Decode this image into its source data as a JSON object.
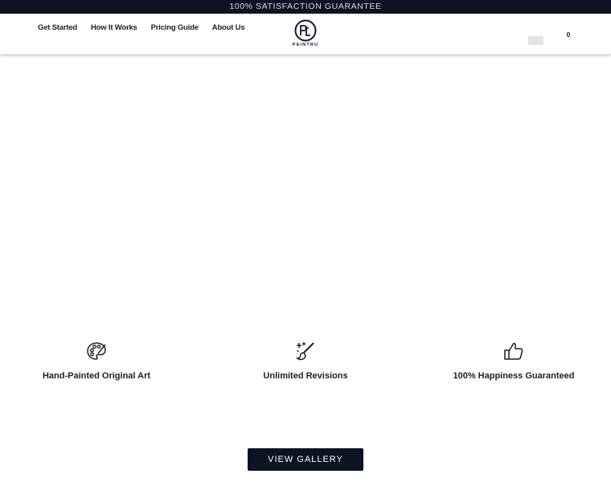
{
  "announcement": "100% SATISFACTION GUARANTEE",
  "nav": {
    "items": [
      {
        "label": "Get Started"
      },
      {
        "label": "How It Works"
      },
      {
        "label": "Pricing Guide"
      },
      {
        "label": "About Us"
      }
    ]
  },
  "logo": {
    "monogram": "PtL",
    "wordmark": "PAINTRU"
  },
  "cart": {
    "count": "0",
    "icon": "cart-icon"
  },
  "features": [
    {
      "icon": "palette-icon",
      "label": "Hand-Painted Original Art"
    },
    {
      "icon": "brush-sparkle-icon",
      "label": "Unlimited Revisions"
    },
    {
      "icon": "thumbs-up-icon",
      "label": "100% Happiness Guaranteed"
    }
  ],
  "cta": {
    "label": "VIEW GALLERY"
  },
  "colors": {
    "dark": "#0d1322",
    "text": "#1a1f2b"
  }
}
